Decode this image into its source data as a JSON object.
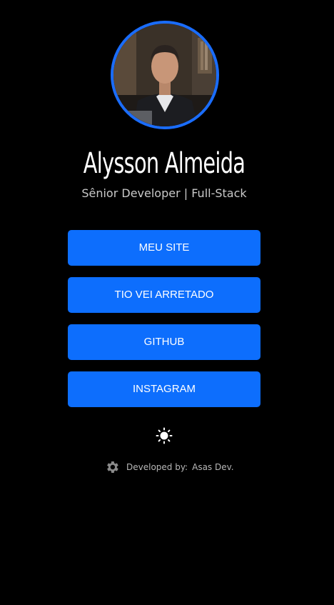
{
  "profile": {
    "name": "Alysson Almeida",
    "role": "Sênior Developer | Full-Stack",
    "avatar_alt": "Profile photo"
  },
  "links": [
    {
      "label": "MEU SITE"
    },
    {
      "label": "TIO VEI ARRETADO"
    },
    {
      "label": "GITHUB"
    },
    {
      "label": "INSTAGRAM"
    }
  ],
  "theme_toggle": {
    "icon": "sun-icon"
  },
  "footer": {
    "icon": "gear-icon",
    "label": "Developed by:",
    "developer": "Asas Dev."
  },
  "colors": {
    "background": "#000000",
    "accent": "#0d6efd",
    "ring": "#1a6dff",
    "text": "#ffffff",
    "muted_text": "#c9c9c9"
  }
}
